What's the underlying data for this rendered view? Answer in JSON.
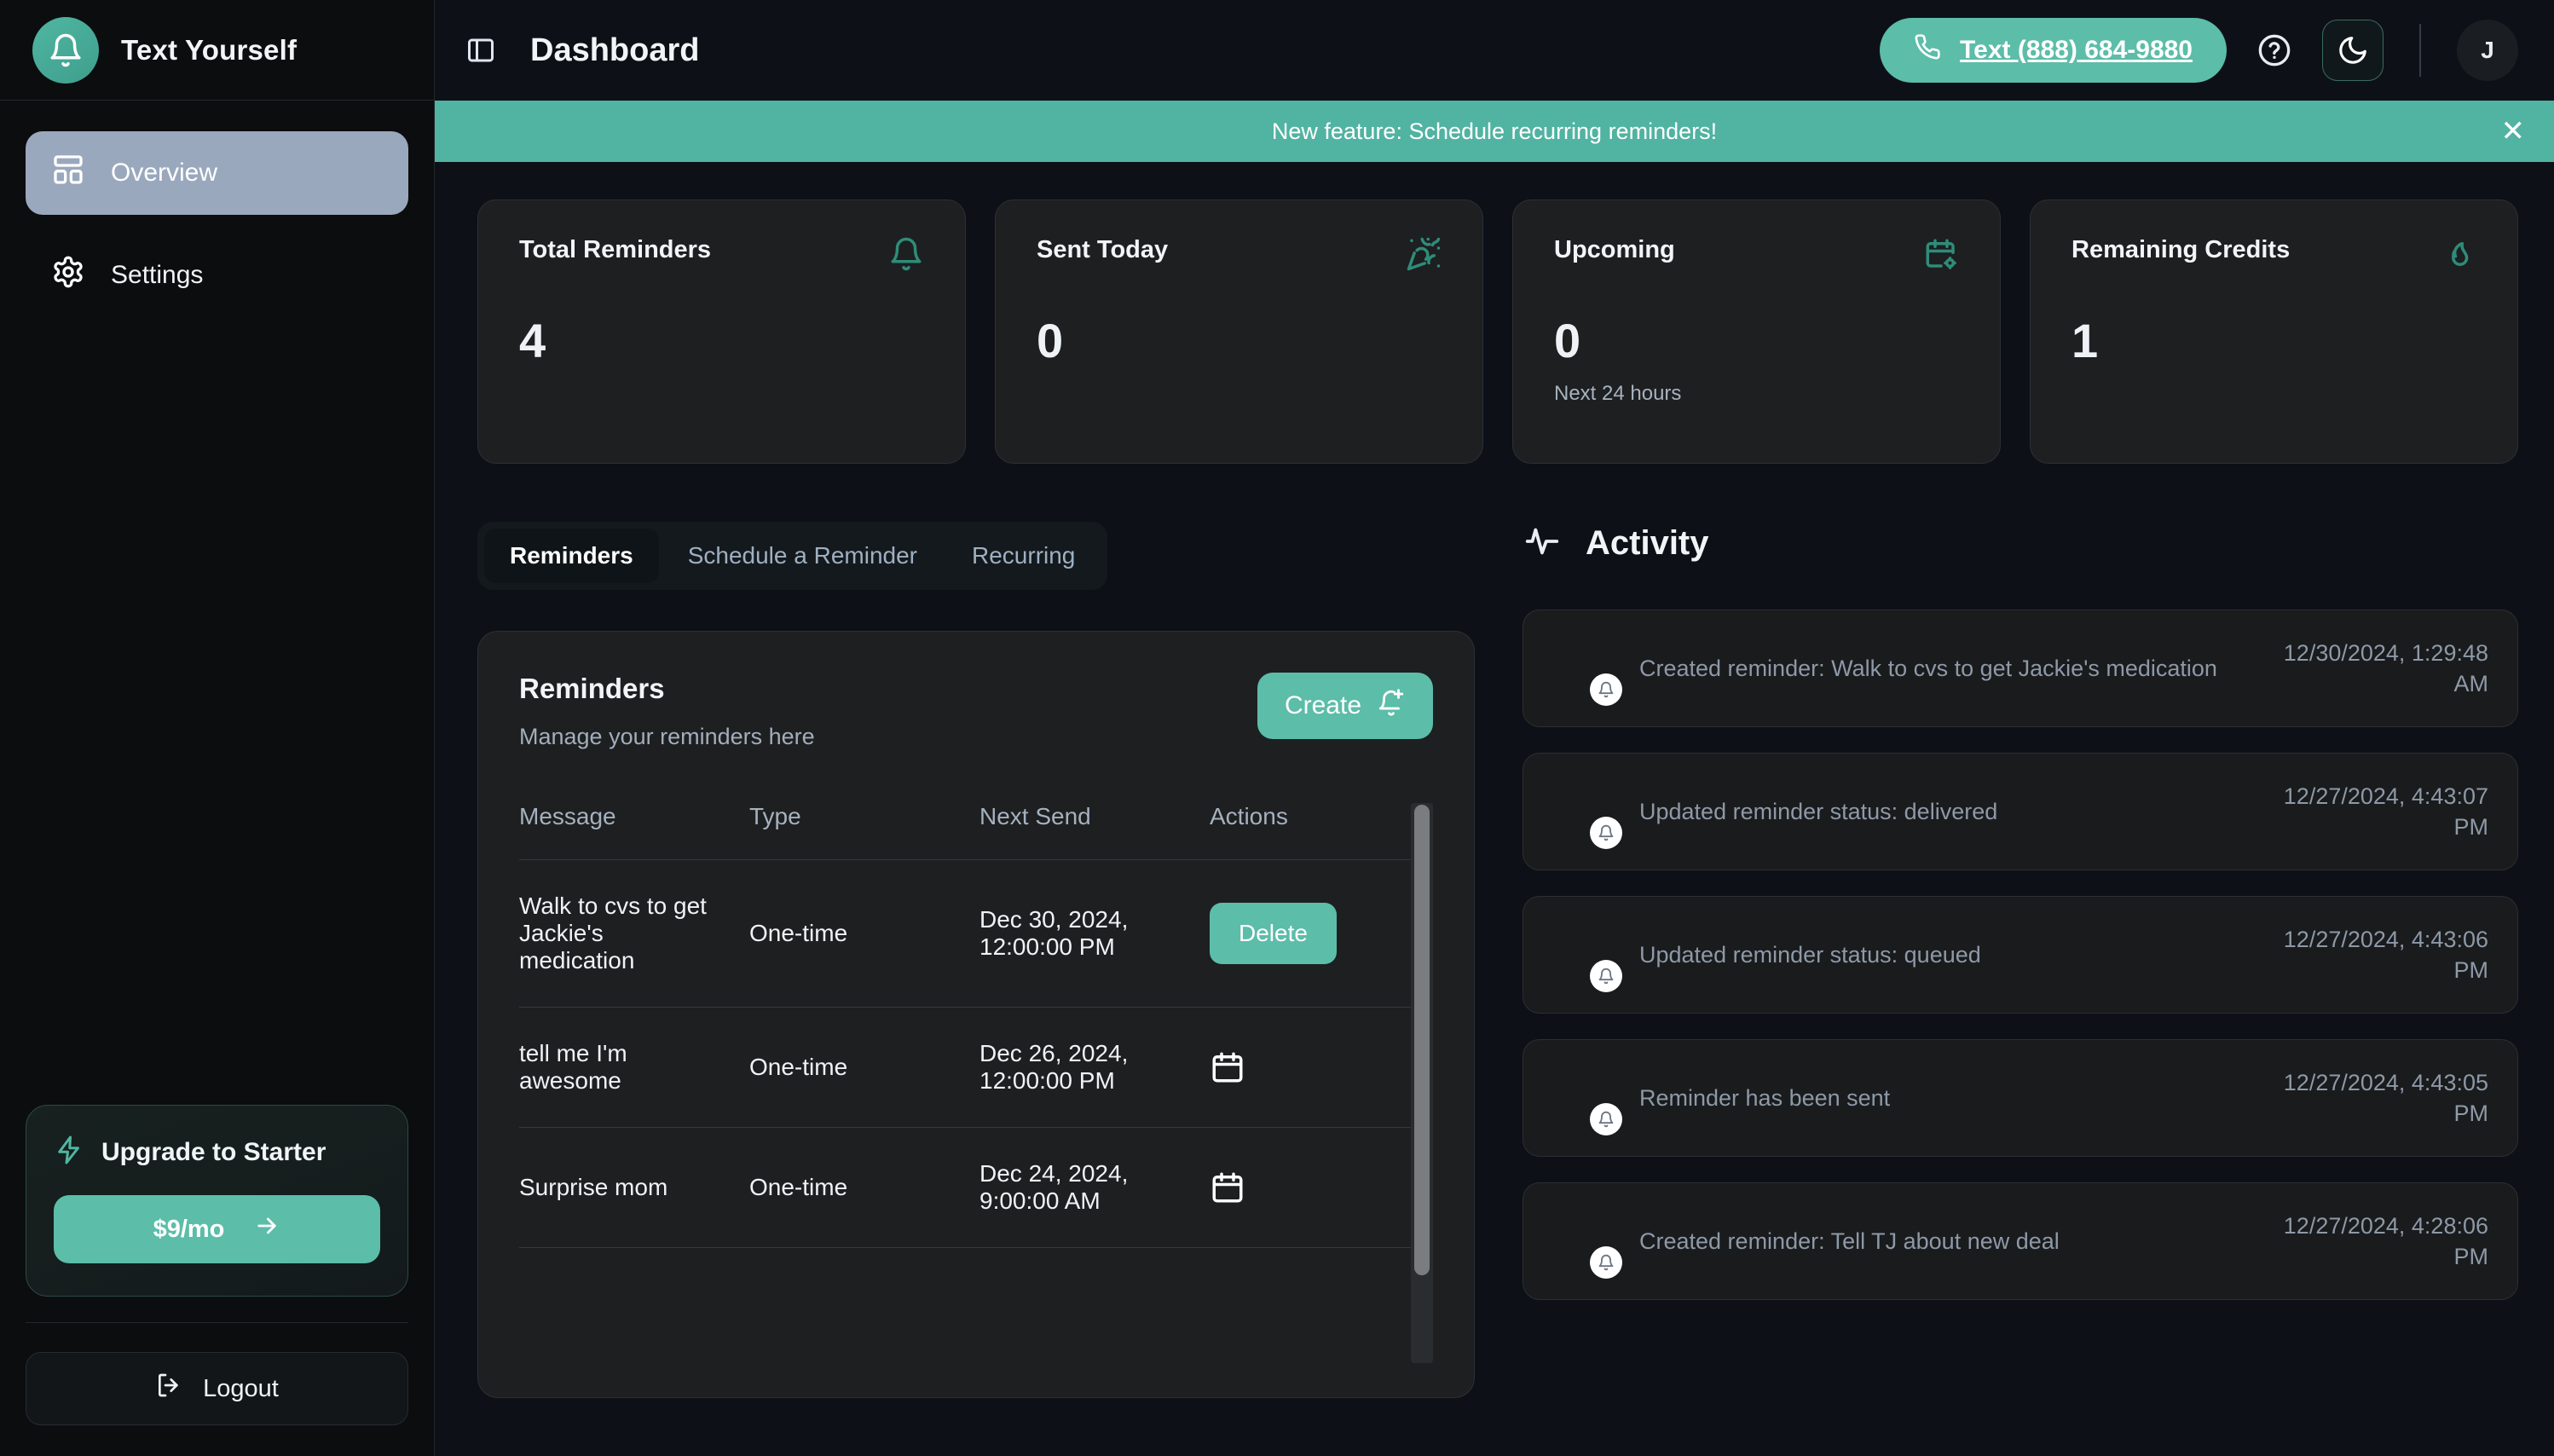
{
  "brand": {
    "name": "Text Yourself",
    "logo_icon": "bell-icon",
    "accent": "#4fb6a2"
  },
  "sidebar": {
    "items": [
      {
        "label": "Overview",
        "icon": "layout-dashboard-icon",
        "active": true
      },
      {
        "label": "Settings",
        "icon": "gear-icon",
        "active": false
      }
    ],
    "upgrade": {
      "title": "Upgrade to Starter",
      "icon": "lightning-bolt-icon",
      "price_label": "$9/mo",
      "arrow_icon": "arrow-right-icon"
    },
    "logout": {
      "label": "Logout",
      "icon": "logout-icon"
    }
  },
  "header": {
    "panel_toggle_icon": "panel-left-icon",
    "title": "Dashboard",
    "phone_button": {
      "label": "Text (888) 684-9880",
      "icon": "phone-icon"
    },
    "help_icon": "help-circle-icon",
    "theme_icon": "moon-icon",
    "avatar_initial": "J"
  },
  "banner": {
    "text": "New feature: Schedule recurring reminders!",
    "close_icon": "close-icon",
    "color": "#51b3a2"
  },
  "stats": [
    {
      "label": "Total Reminders",
      "value": "4",
      "sub": "",
      "icon": "bell-icon"
    },
    {
      "label": "Sent Today",
      "value": "0",
      "sub": "",
      "icon": "party-popper-icon"
    },
    {
      "label": "Upcoming",
      "value": "0",
      "sub": "Next 24 hours",
      "icon": "calendar-cog-icon"
    },
    {
      "label": "Remaining Credits",
      "value": "1",
      "sub": "",
      "icon": "flame-icon"
    }
  ],
  "tabs": [
    {
      "label": "Reminders",
      "active": true
    },
    {
      "label": "Schedule a Reminder",
      "active": false
    },
    {
      "label": "Recurring",
      "active": false
    }
  ],
  "reminders_card": {
    "title": "Reminders",
    "subtitle": "Manage your reminders here",
    "create_button": {
      "label": "Create",
      "icon": "bell-plus-icon"
    },
    "columns": [
      "Message",
      "Type",
      "Next Send",
      "Actions"
    ],
    "rows": [
      {
        "message": "Walk to cvs to get Jackie's medication",
        "type": "One-time",
        "next_send": "Dec 30, 2024, 12:00:00 PM",
        "action": {
          "kind": "button",
          "label": "Delete"
        }
      },
      {
        "message": "tell me I'm awesome",
        "type": "One-time",
        "next_send": "Dec 26, 2024, 12:00:00 PM",
        "action": {
          "kind": "icon",
          "label": "",
          "icon": "calendar-icon"
        }
      },
      {
        "message": "Surprise mom",
        "type": "One-time",
        "next_send": "Dec 24, 2024, 9:00:00 AM",
        "action": {
          "kind": "icon",
          "label": "",
          "icon": "calendar-icon"
        }
      }
    ]
  },
  "activity": {
    "title": "Activity",
    "icon": "activity-pulse-icon",
    "items": [
      {
        "text": "Created reminder: Walk to cvs to get Jackie's medication",
        "time": "12/30/2024, 1:29:48 AM",
        "badge_icon": "bell-icon"
      },
      {
        "text": "Updated reminder status: delivered",
        "time": "12/27/2024, 4:43:07 PM",
        "badge_icon": "bell-icon"
      },
      {
        "text": "Updated reminder status: queued",
        "time": "12/27/2024, 4:43:06 PM",
        "badge_icon": "bell-icon"
      },
      {
        "text": "Reminder has been sent",
        "time": "12/27/2024, 4:43:05 PM",
        "badge_icon": "bell-icon"
      },
      {
        "text": "Created reminder: Tell TJ about new deal",
        "time": "12/27/2024, 4:28:06 PM",
        "badge_icon": "bell-icon"
      }
    ]
  }
}
